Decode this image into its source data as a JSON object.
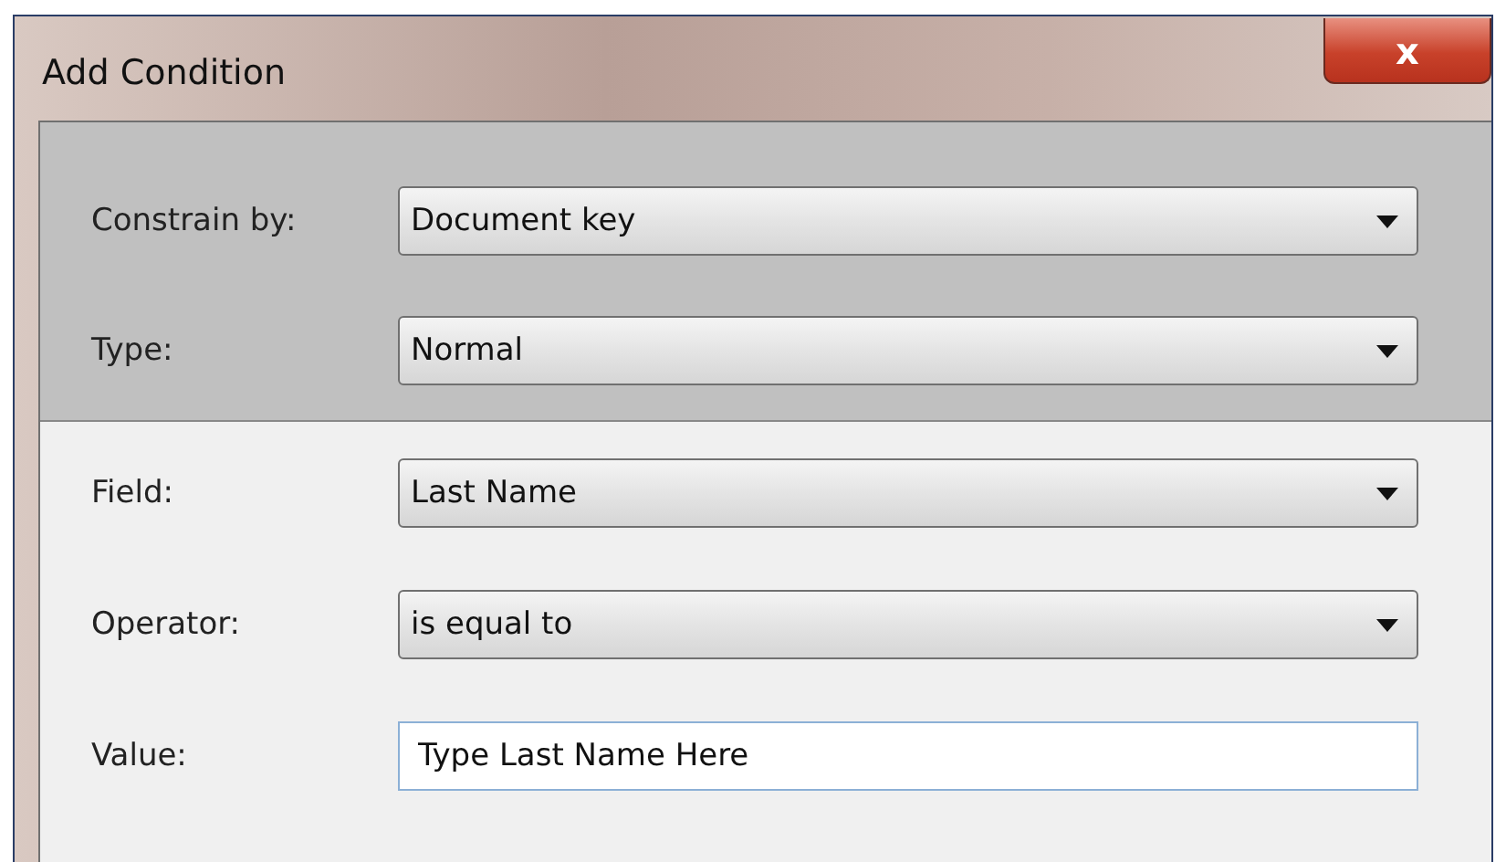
{
  "window": {
    "title": "Add Condition",
    "close_glyph": "x"
  },
  "sections": [
    {
      "kind": "shaded",
      "rows": [
        {
          "label": "Constrain by:",
          "kind": "dropdown",
          "value": "Document key"
        },
        {
          "label": "Type:",
          "kind": "dropdown",
          "value": "Normal"
        }
      ]
    },
    {
      "kind": "plain",
      "rows": [
        {
          "label": "Field:",
          "kind": "dropdown",
          "value": "Last Name"
        },
        {
          "label": "Operator:",
          "kind": "dropdown",
          "value": "is equal to"
        },
        {
          "label": "Value:",
          "kind": "text",
          "value": "Type Last Name Here"
        }
      ]
    }
  ]
}
